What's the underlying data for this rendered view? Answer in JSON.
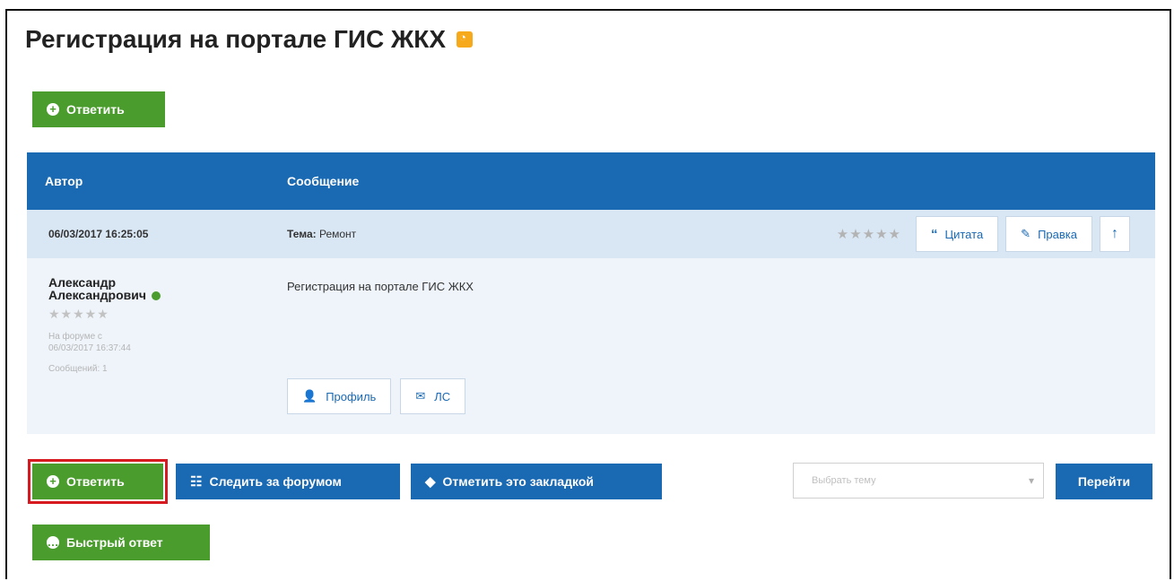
{
  "page": {
    "title": "Регистрация на портале ГИС ЖКХ"
  },
  "top_reply_button": {
    "label": "Ответить"
  },
  "table": {
    "col_author": "Автор",
    "col_message": "Сообщение"
  },
  "post": {
    "date": "06/03/2017 16:25:05",
    "topic_label": "Тема:",
    "topic_value": "Ремонт",
    "rating_stars": "★★★★★",
    "quote_label": "Цитата",
    "edit_label": "Правка",
    "author_line1": "Александр",
    "author_line2": "Александрович",
    "author_stars": "★★★★★",
    "on_forum_label": "На форуме с",
    "on_forum_date": "06/03/2017 16:37:44",
    "messages_label": "Сообщений: 1",
    "text": "Регистрация на портале ГИС ЖКХ",
    "profile_label": "Профиль",
    "pm_label": "ЛС"
  },
  "actions": {
    "reply_label": "Ответить",
    "follow_label": "Следить за форумом",
    "bookmark_label": "Отметить это закладкой",
    "select_placeholder": "Выбрать тему",
    "go_label": "Перейти",
    "quick_reply_label": "Быстрый ответ"
  },
  "colors": {
    "green": "#4a9c2d",
    "blue": "#1a69b3",
    "highlight": "#d71920"
  }
}
